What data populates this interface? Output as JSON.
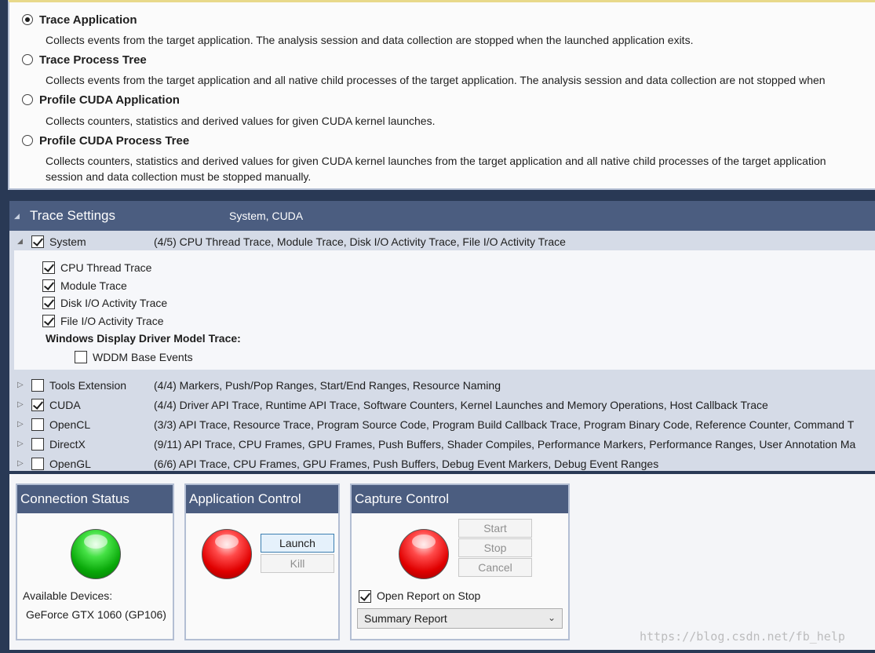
{
  "activities": [
    {
      "label": "Trace Application",
      "selected": true,
      "description": [
        "Collects events from the target application. The analysis session and data collection are stopped when the launched application exits."
      ]
    },
    {
      "label": "Trace Process Tree",
      "selected": false,
      "description": [
        "Collects events from the target application and all native child processes of the target application. The analysis session and data collection are not stopped when"
      ]
    },
    {
      "label": "Profile CUDA Application",
      "selected": false,
      "description": [
        "Collects counters, statistics and derived values for given CUDA kernel launches."
      ]
    },
    {
      "label": "Profile CUDA Process Tree",
      "selected": false,
      "description": [
        "Collects counters, statistics and derived values for given CUDA kernel launches from the target application and all native child processes of the target application",
        "session and data collection must be stopped manually."
      ]
    }
  ],
  "trace_settings": {
    "title": "Trace Settings",
    "summary": "System, CUDA",
    "system": {
      "name": "System",
      "checked": true,
      "summary": "(4/5) CPU Thread Trace, Module Trace, Disk I/O Activity Trace, File I/O Activity Trace",
      "options": [
        {
          "label": "CPU Thread Trace",
          "checked": true
        },
        {
          "label": "Module Trace",
          "checked": true
        },
        {
          "label": "Disk I/O Activity Trace",
          "checked": true
        },
        {
          "label": "File I/O Activity Trace",
          "checked": true
        }
      ],
      "wddm_heading": "Windows Display Driver Model Trace:",
      "wddm_option": {
        "label": "WDDM Base Events",
        "checked": false
      }
    },
    "categories": [
      {
        "name": "Tools Extension",
        "checked": false,
        "summary": "(4/4) Markers, Push/Pop Ranges, Start/End Ranges, Resource Naming"
      },
      {
        "name": "CUDA",
        "checked": true,
        "summary": "(4/4) Driver API Trace, Runtime API Trace, Software Counters, Kernel Launches and Memory Operations, Host Callback Trace"
      },
      {
        "name": "OpenCL",
        "checked": false,
        "summary": "(3/3) API Trace, Resource Trace, Program Source Code, Program Build Callback Trace, Program Binary Code, Reference Counter, Command T"
      },
      {
        "name": "DirectX",
        "checked": false,
        "summary": "(9/11) API Trace, CPU Frames, GPU Frames, Push Buffers, Shader Compiles, Performance Markers, Performance Ranges, User Annotation Ma"
      },
      {
        "name": "OpenGL",
        "checked": false,
        "summary": "(6/6) API Trace, CPU Frames, GPU Frames, Push Buffers, Debug Event Markers, Debug Event Ranges"
      }
    ]
  },
  "connection": {
    "title": "Connection Status",
    "status_color": "#18b818",
    "devices_label": "Available Devices:",
    "device": "GeForce GTX 1060 (GP106)"
  },
  "application_control": {
    "title": "Application Control",
    "status_color": "#e81010",
    "launch_label": "Launch",
    "kill_label": "Kill"
  },
  "capture_control": {
    "title": "Capture Control",
    "status_color": "#e81010",
    "start_label": "Start",
    "stop_label": "Stop",
    "cancel_label": "Cancel",
    "open_report_label": "Open Report on Stop",
    "open_report_checked": true,
    "report_selected": "Summary Report"
  },
  "watermark": "https://blog.csdn.net/fb_help"
}
